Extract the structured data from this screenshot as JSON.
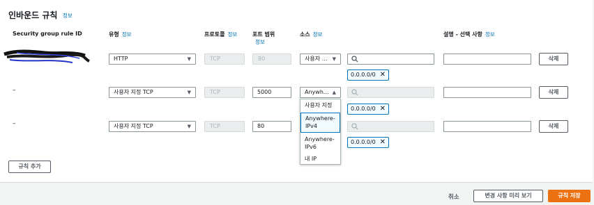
{
  "panel": {
    "title": "인바운드 규칙",
    "info": "정보"
  },
  "headers": {
    "rule_id": "Security group rule ID",
    "type": "유형",
    "protocol": "프로토콜",
    "port_range": "포트 범위",
    "source": "소스",
    "description": "설명 - 선택 사항",
    "info": "정보"
  },
  "rules": [
    {
      "rule_id": "",
      "type": "HTTP",
      "protocol": "TCP",
      "port": "80",
      "source": "사용자 ...",
      "search_value": "",
      "token": "0.0.0.0/0",
      "description": "",
      "delete": "삭제"
    },
    {
      "rule_id": "–",
      "type": "사용자 지정 TCP",
      "protocol": "TCP",
      "port": "5000",
      "source": "Anywh...",
      "search_value": "",
      "token": "0.0.0.0/0",
      "description": "",
      "delete": "삭제"
    },
    {
      "rule_id": "–",
      "type": "사용자 지정 TCP",
      "protocol": "TCP",
      "port": "80",
      "source": "",
      "search_value": "",
      "token": "0.0.0.0/0",
      "description": "",
      "delete": "삭제"
    }
  ],
  "source_dropdown": {
    "options": [
      "사용자 지정",
      "Anywhere-IPv4",
      "Anywhere-IPv6",
      "내 IP"
    ],
    "highlighted": "Anywhere-IPv4"
  },
  "add_rule": "규칙 추가",
  "footer": {
    "cancel": "취소",
    "preview": "변경 사항 미리 보기",
    "save": "규칙 저장"
  },
  "colors": {
    "primary": "#ec7211",
    "link": "#0073bb",
    "token_border": "#0073bb"
  }
}
